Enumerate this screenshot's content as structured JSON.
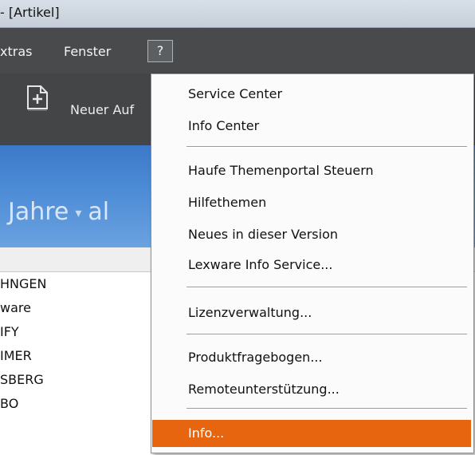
{
  "window": {
    "title": "- [Artikel]"
  },
  "menubar": {
    "extras_label": "xtras",
    "fenster_label": "Fenster",
    "help_label": "?"
  },
  "toolbar": {
    "new_label": "Neuer Auf"
  },
  "banner": {
    "text_left": "Jahre",
    "text_right": "al"
  },
  "list": {
    "rows": [
      "HNGEN",
      "ware",
      "IFY",
      "IMER",
      "SBERG",
      "BO"
    ]
  },
  "help_menu": {
    "items": [
      {
        "label": "Service Center"
      },
      {
        "label": "Info Center"
      },
      {
        "label": "Haufe Themenportal Steuern"
      },
      {
        "label": "Hilfethemen"
      },
      {
        "label": "Neues in dieser Version"
      },
      {
        "label": "Lexware Info Service..."
      },
      {
        "label": "Lizenzverwaltung..."
      },
      {
        "label": "Produktfragebogen..."
      },
      {
        "label": "Remoteunterstützung..."
      },
      {
        "label": "Info..."
      }
    ],
    "active_color": "#e8650f"
  }
}
